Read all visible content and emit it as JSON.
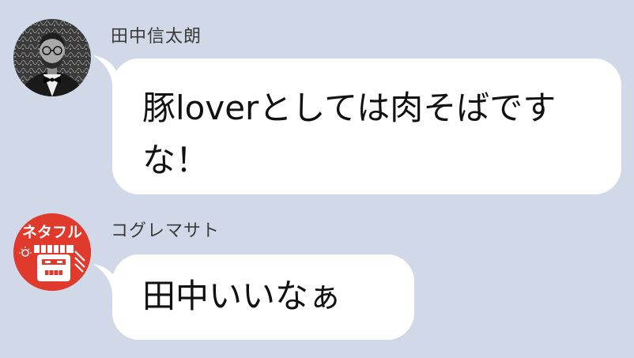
{
  "messages": [
    {
      "sender": "田中信太朗",
      "avatar_icon": "bearded-man-bowtie-photo",
      "text": "豚loverとしては肉そばですな！"
    },
    {
      "sender": "コグレマサト",
      "avatar_icon": "netafull-logo",
      "avatar_logo_text": "ネタフル",
      "text": "田中いいなぁ"
    }
  ],
  "colors": {
    "background": "#d1d9e8",
    "bubble": "#ffffff",
    "netafull_red": "#e03a2c"
  }
}
